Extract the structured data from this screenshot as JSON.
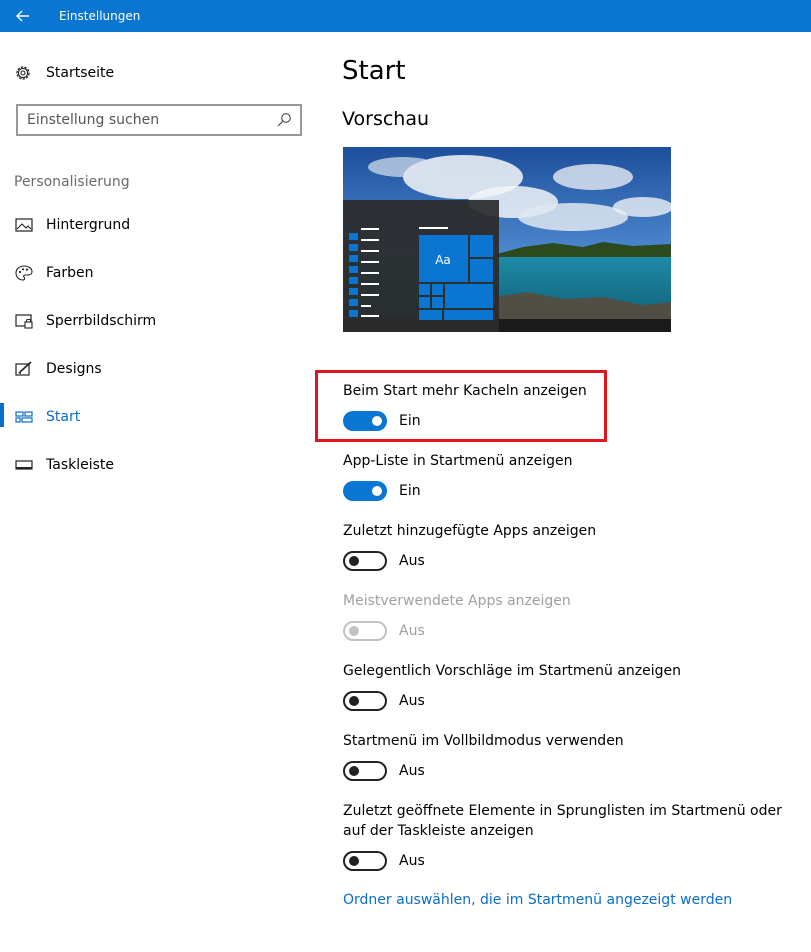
{
  "window": {
    "title": "Einstellungen",
    "accent": "#0a76d1"
  },
  "sidebar": {
    "home_label": "Startseite",
    "search_placeholder": "Einstellung suchen",
    "section_label": "Personalisierung",
    "items": [
      {
        "label": "Hintergrund",
        "icon": "picture-icon",
        "active": false
      },
      {
        "label": "Farben",
        "icon": "palette-icon",
        "active": false
      },
      {
        "label": "Sperrbildschirm",
        "icon": "lock-screen-icon",
        "active": false
      },
      {
        "label": "Designs",
        "icon": "paint-brush-icon",
        "active": false
      },
      {
        "label": "Start",
        "icon": "start-tiles-icon",
        "active": true
      },
      {
        "label": "Taskleiste",
        "icon": "taskbar-icon",
        "active": false
      }
    ]
  },
  "main": {
    "title": "Start",
    "preview_heading": "Vorschau",
    "preview_tile_label": "Aa",
    "settings": [
      {
        "label": "Beim Start mehr Kacheln anzeigen",
        "state": "Ein",
        "on": true,
        "disabled": false
      },
      {
        "label": "App-Liste in Startmenü anzeigen",
        "state": "Ein",
        "on": true,
        "disabled": false
      },
      {
        "label": "Zuletzt hinzugefügte Apps anzeigen",
        "state": "Aus",
        "on": false,
        "disabled": false
      },
      {
        "label": "Meistverwendete Apps anzeigen",
        "state": "Aus",
        "on": false,
        "disabled": true
      },
      {
        "label": "Gelegentlich Vorschläge im Startmenü anzeigen",
        "state": "Aus",
        "on": false,
        "disabled": false
      },
      {
        "label": "Startmenü im Vollbildmodus verwenden",
        "state": "Aus",
        "on": false,
        "disabled": false
      },
      {
        "label": "Zuletzt geöffnete Elemente in Sprunglisten im Startmenü oder auf der Taskleiste anzeigen",
        "state": "Aus",
        "on": false,
        "disabled": false
      }
    ],
    "link": "Ordner auswählen, die im Startmenü angezeigt werden"
  }
}
